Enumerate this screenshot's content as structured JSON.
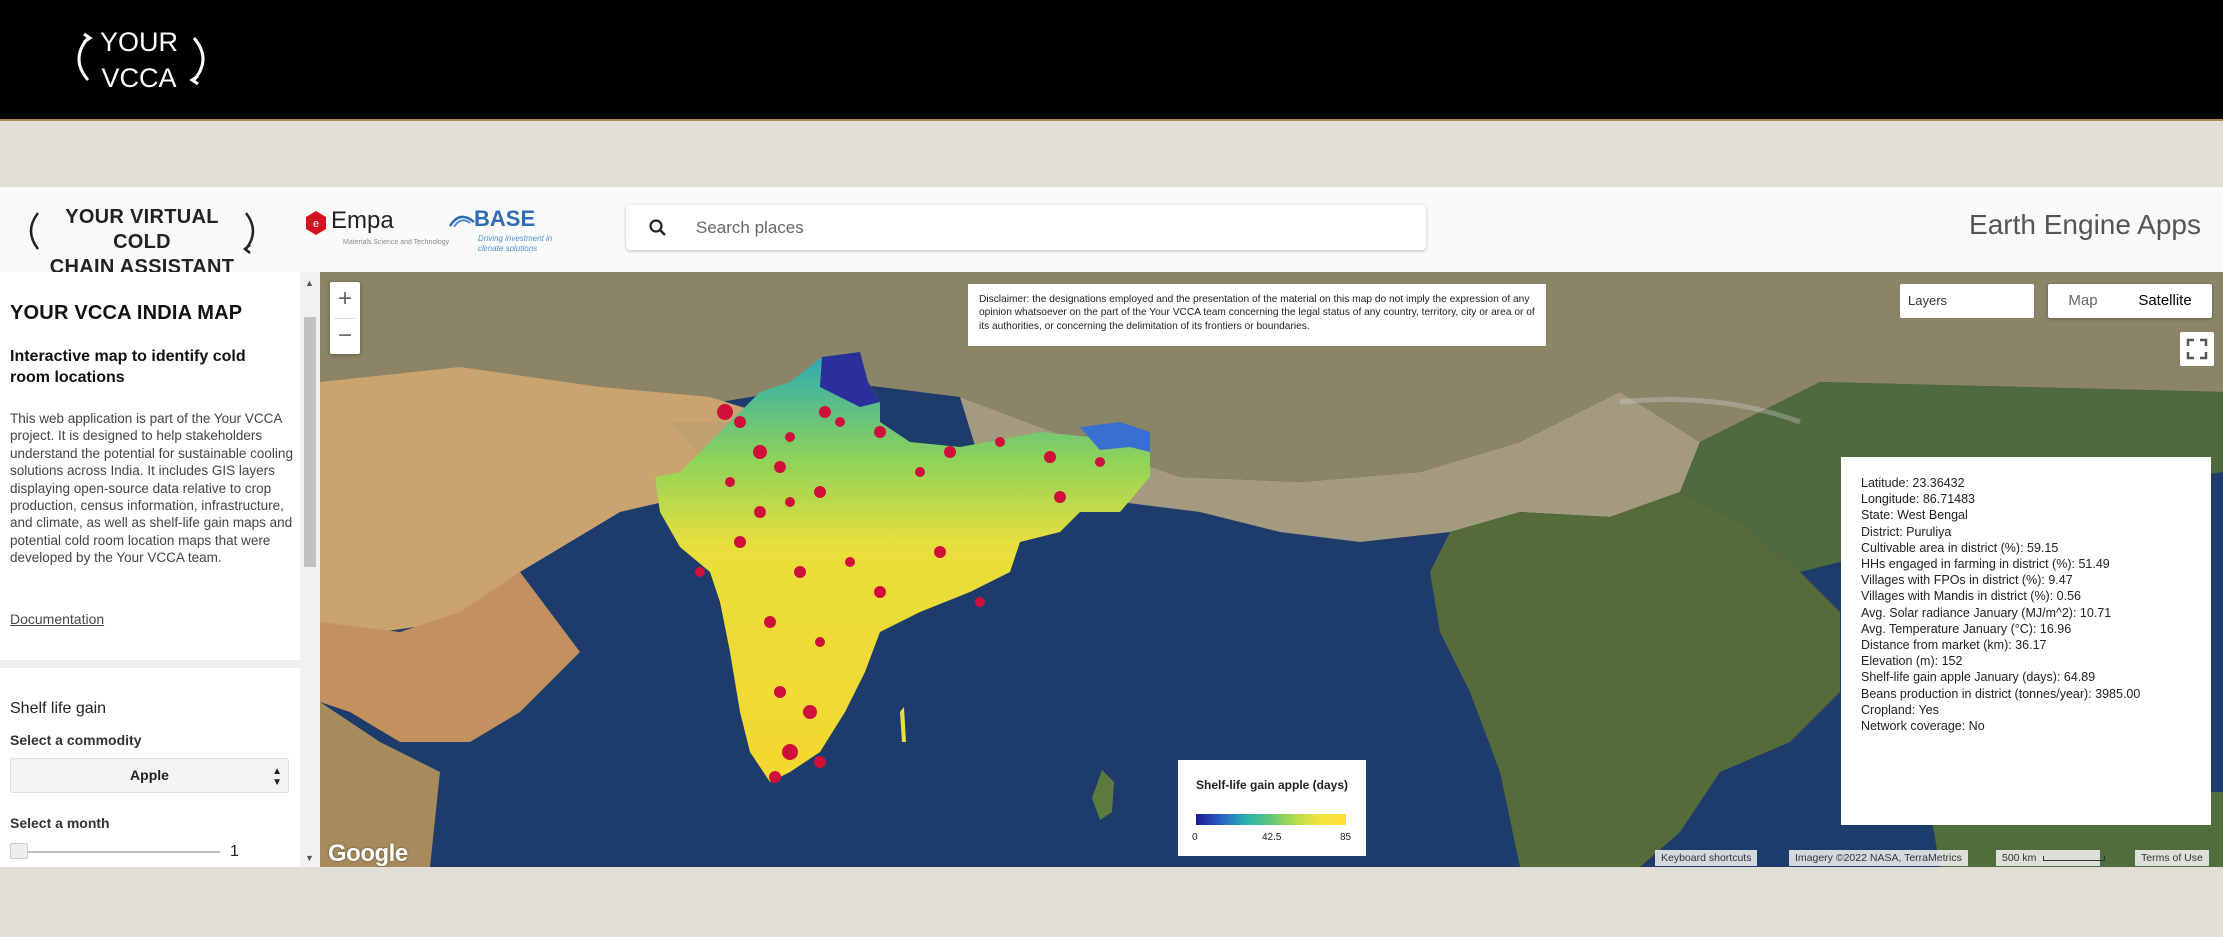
{
  "banner": {
    "logo_line1": "YOUR",
    "logo_line2": "VCCA"
  },
  "header": {
    "vcca_logo_line1": "YOUR VIRTUAL COLD",
    "vcca_logo_line2": "CHAIN ASSISTANT",
    "empa_name": "Empa",
    "empa_sub": "Materials Science and Technology",
    "base_name": "BASE",
    "base_sub": "Driving investment in climate solutions",
    "search_placeholder": "Search places",
    "app_title": "Earth Engine Apps"
  },
  "panel": {
    "title": "YOUR VCCA INDIA MAP",
    "subtitle": "Interactive map to identify cold room locations",
    "description": "This web application is part of the Your VCCA project. It is designed to help stakeholders understand the potential for sustainable cooling solutions across India. It includes GIS layers displaying open-source data relative to crop production, census information, infrastructure, and climate, as well as shelf-life gain maps and potential cold room location maps that were developed by the Your VCCA team.",
    "documentation_link": "Documentation",
    "shelf_title": "Shelf life gain",
    "commodity_label": "Select a commodity",
    "commodity_value": "Apple",
    "month_label": "Select a month",
    "month_value": "1"
  },
  "map": {
    "disclaimer": "Disclaimer: the designations employed and the presentation of the material on this map do not imply the expression of any opinion whatsoever on the part of the Your VCCA team concerning the legal status of any country, territory, city or area or of its authorities, or concerning the delimitation of its frontiers or boundaries.",
    "zoom_in": "+",
    "zoom_out": "−",
    "layers_label": "Layers",
    "map_type_map": "Map",
    "map_type_satellite": "Satellite",
    "info_lines": [
      "Latitude: 23.36432",
      "Longitude: 86.71483",
      "State: West Bengal",
      "District: Puruliya",
      "Cultivable area in district (%): 59.15",
      "HHs engaged in farming in district (%): 51.49",
      "Villages with FPOs in district (%): 9.47",
      "Villages with Mandis in district (%): 0.56",
      "Avg. Solar radiance January (MJ/m^2): 10.71",
      "Avg. Temperature January (°C): 16.96",
      "Distance from market (km): 36.17",
      "Elevation (m): 152",
      "Shelf-life gain apple January (days): 64.89",
      "Beans production in district (tonnes/year): 3985.00",
      "Cropland: Yes",
      "Network coverage: No"
    ],
    "legend_title": "Shelf-life gain apple (days)",
    "legend_min": "0",
    "legend_mid": "42.5",
    "legend_max": "85",
    "google_logo": "Google",
    "keyboard_shortcuts": "Keyboard shortcuts",
    "imagery_credit": "Imagery ©2022 NASA, TerraMetrics",
    "scale_label": "500 km",
    "terms": "Terms of Use"
  },
  "colors": {
    "banner_bg": "#000000",
    "page_bg": "#e1ded5",
    "ocean": "#1d3c6b",
    "land": "#b79a6e",
    "hotspot": "#d0103a",
    "base_blue": "#2e6db5",
    "empa_red": "#d4111e"
  }
}
